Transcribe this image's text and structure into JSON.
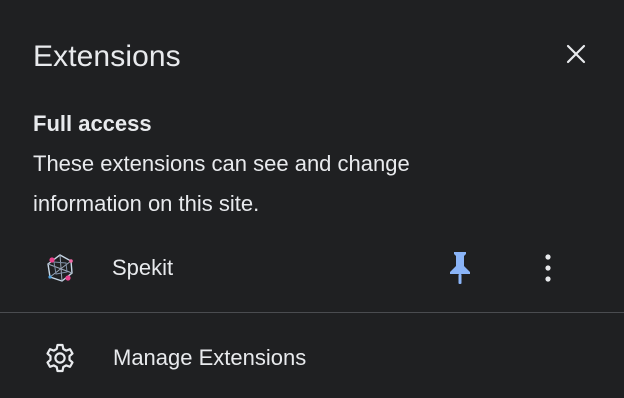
{
  "panel": {
    "title": "Extensions",
    "close_icon": "close-icon"
  },
  "full_access": {
    "heading": "Full access",
    "description": "These extensions can see and change information on this site."
  },
  "extensions": [
    {
      "name": "Spekit",
      "icon": "spekit-logo-icon",
      "pinned": true,
      "pin_icon": "pin-icon",
      "menu_icon": "more-vertical-icon"
    }
  ],
  "manage": {
    "label": "Manage Extensions",
    "icon": "gear-icon"
  },
  "colors": {
    "background": "#1f2022",
    "text": "#e8eaed",
    "accent_pin": "#8ab4f8",
    "divider": "#4a4c50"
  }
}
